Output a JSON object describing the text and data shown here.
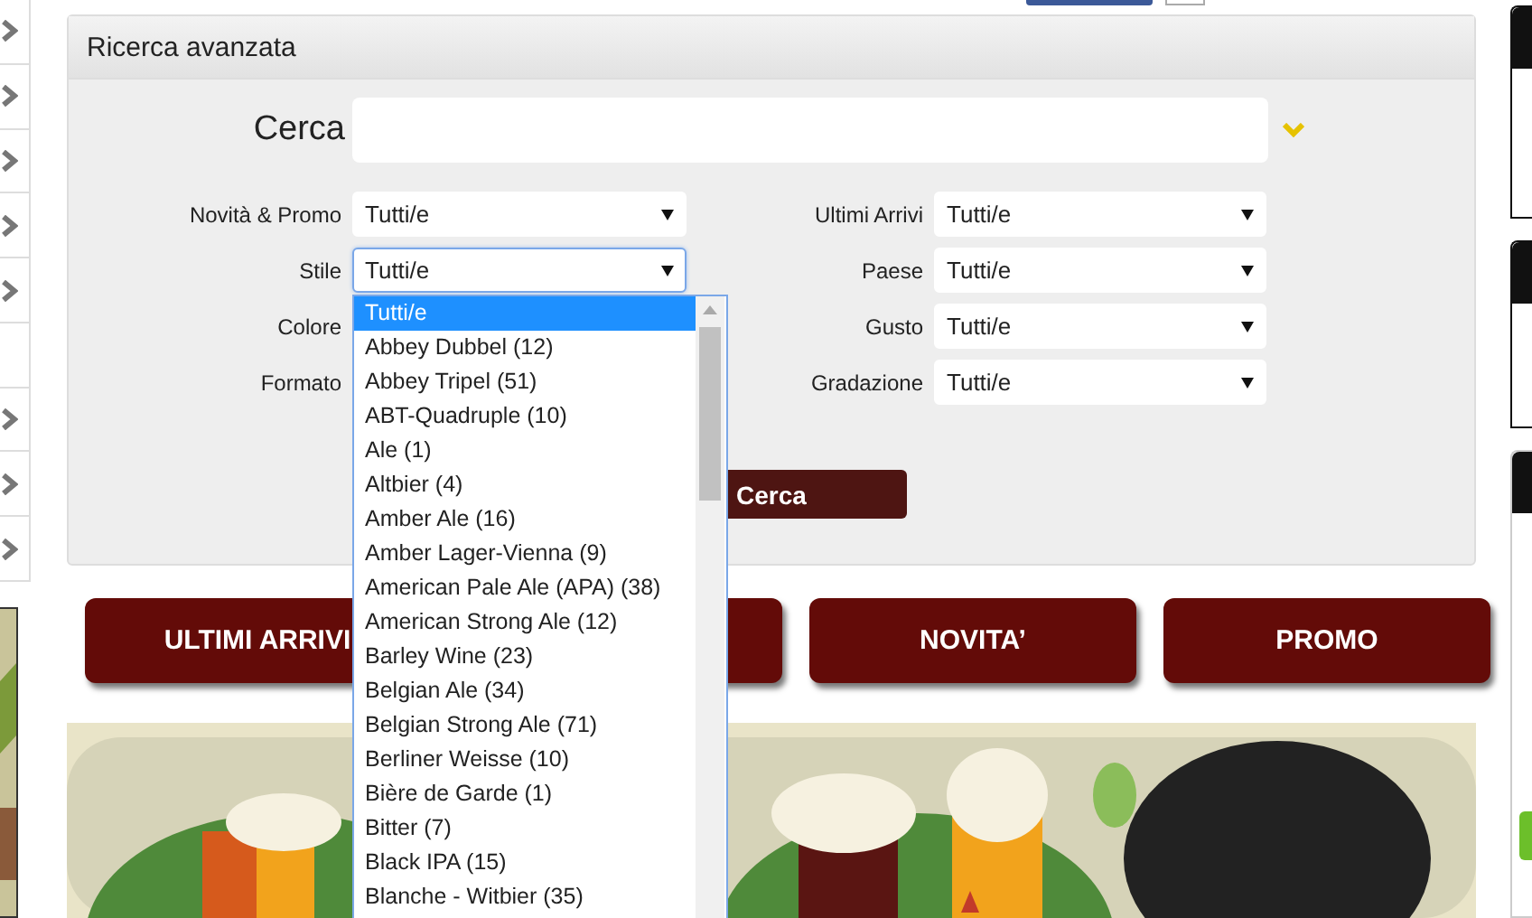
{
  "panel": {
    "title": "Ricerca avanzata"
  },
  "search": {
    "label": "Cerca"
  },
  "fields": [
    {
      "label": "Novità & Promo",
      "value": "Tutti/e",
      "focused": false
    },
    {
      "label": "Ultimi Arrivi",
      "value": "Tutti/e",
      "focused": false
    },
    {
      "label": "Stile",
      "value": "Tutti/e",
      "focused": true
    },
    {
      "label": "Paese",
      "value": "Tutti/e",
      "focused": false
    },
    {
      "label": "Colore"
    },
    {
      "label": "Gusto",
      "value": "Tutti/e",
      "focused": false
    },
    {
      "label": "Formato"
    },
    {
      "label": "Gradazione",
      "value": "Tutti/e",
      "focused": false
    }
  ],
  "search_button": {
    "label": "Cerca"
  },
  "dropdown_options": [
    {
      "label": "Tutti/e",
      "selected": true
    },
    {
      "label": "Abbey Dubbel (12)",
      "selected": false
    },
    {
      "label": "Abbey Tripel (51)",
      "selected": false
    },
    {
      "label": "ABT-Quadruple (10)",
      "selected": false
    },
    {
      "label": "Ale (1)",
      "selected": false
    },
    {
      "label": "Altbier (4)",
      "selected": false
    },
    {
      "label": "Amber Ale (16)",
      "selected": false
    },
    {
      "label": "Amber Lager-Vienna (9)",
      "selected": false
    },
    {
      "label": "American Pale Ale (APA) (38)",
      "selected": false
    },
    {
      "label": "American Strong Ale (12)",
      "selected": false
    },
    {
      "label": "Barley Wine (23)",
      "selected": false
    },
    {
      "label": "Belgian Ale (34)",
      "selected": false
    },
    {
      "label": "Belgian Strong Ale (71)",
      "selected": false
    },
    {
      "label": "Berliner Weisse (10)",
      "selected": false
    },
    {
      "label": "Bière de Garde (1)",
      "selected": false
    },
    {
      "label": "Bitter (7)",
      "selected": false
    },
    {
      "label": "Black IPA (15)",
      "selected": false
    },
    {
      "label": "Blanche - Witbier (35)",
      "selected": false
    }
  ],
  "nav_buttons": [
    {
      "kind": "labeled",
      "label": "ULTIMI ARRIVI"
    },
    {
      "kind": "covered"
    },
    {
      "kind": "labeled",
      "label": "NOVITA’"
    },
    {
      "kind": "labeled",
      "label": "PROMO"
    }
  ]
}
